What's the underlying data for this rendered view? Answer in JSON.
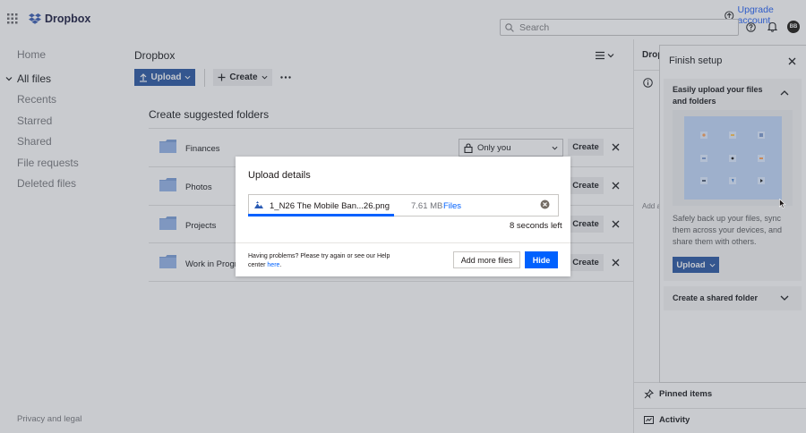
{
  "header": {
    "logo_text": "Dropbox",
    "upgrade_label": "Upgrade account",
    "search_placeholder": "Search",
    "avatar_initials": "BB"
  },
  "sidebar": {
    "items": [
      {
        "label": "Home"
      },
      {
        "label": "All files"
      },
      {
        "label": "Recents"
      },
      {
        "label": "Starred"
      },
      {
        "label": "Shared"
      },
      {
        "label": "File requests"
      },
      {
        "label": "Deleted files"
      }
    ],
    "footer": "Privacy and legal"
  },
  "main": {
    "breadcrumb": "Dropbox",
    "upload_label": "Upload",
    "create_label": "Create",
    "suggest_title": "Create suggested folders",
    "share_select": "Only you",
    "folders": [
      {
        "name": "Finances",
        "action": "Create"
      },
      {
        "name": "Photos",
        "action": "Create"
      },
      {
        "name": "Projects",
        "action": "Create"
      },
      {
        "name": "Work in Progress",
        "action": "Create"
      }
    ]
  },
  "info_panel": {
    "title": "Dropbox",
    "add_text": "Add a",
    "pinned": "Pinned items",
    "activity": "Activity"
  },
  "finish_setup": {
    "title": "Finish setup",
    "card_title": "Easily upload your files and folders",
    "card_desc": "Safely back up your files, sync them across your devices, and share them with others.",
    "card_button": "Upload",
    "shared_title": "Create a shared folder"
  },
  "modal": {
    "title": "Upload details",
    "file_name": "1_N26 The Mobile Ban...26.png",
    "file_size": "7.61 MB",
    "file_location": "Files",
    "progress": 0.47,
    "time_left": "8 seconds left",
    "problems_text": "Having problems? Please try again or see our Help center ",
    "problems_link": "here",
    "problems_end": ".",
    "add_more_label": "Add more files",
    "hide_label": "Hide"
  },
  "colors": {
    "accent": "#0061fe",
    "dimmed_accent": "#34568f",
    "overlay": "#c9cbcf"
  }
}
